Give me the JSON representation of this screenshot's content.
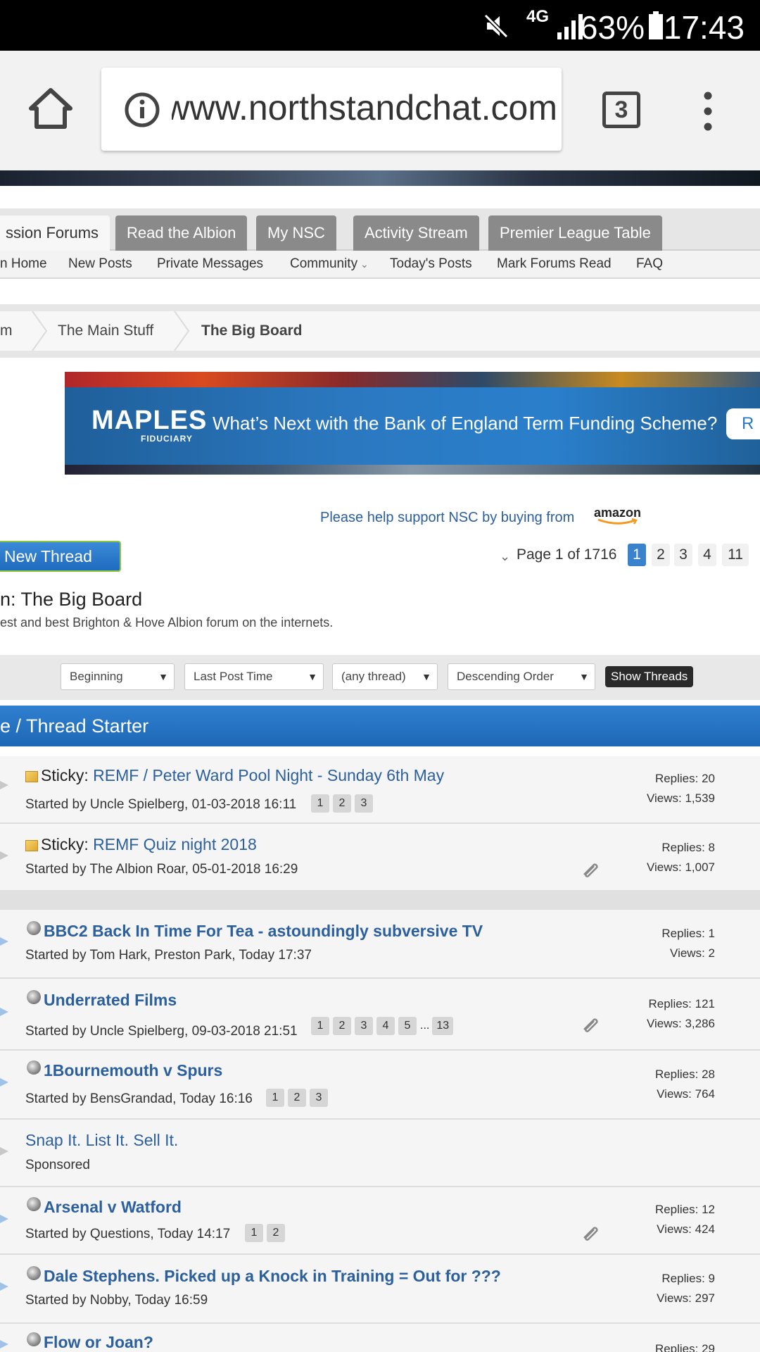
{
  "status_bar": {
    "network": "4G",
    "battery_percent": "63%",
    "time": "17:43"
  },
  "browser": {
    "url": "www.northstandchat.com",
    "tab_count": "3"
  },
  "nav": {
    "tabs": [
      "ssion Forums",
      "Read the Albion",
      "My NSC",
      "Activity Stream",
      "Premier League Table"
    ],
    "subnav": [
      "n Home",
      "New Posts",
      "Private Messages",
      "Community",
      "Today's Posts",
      "Mark Forums Read",
      "FAQ"
    ]
  },
  "breadcrumb": {
    "items": [
      "m",
      "The Main Stuff",
      "The Big Board"
    ]
  },
  "banner": {
    "brand": "MAPLES",
    "brand_sub": "FIDUCIARY",
    "headline": "What’s Next with the Bank of England Term Funding Scheme?",
    "cta": "R"
  },
  "support": {
    "text": "Please help support NSC by buying from",
    "amazon": "amazon"
  },
  "toolbar": {
    "new_thread": "New Thread",
    "page_label": "Page 1 of 1716",
    "pages": [
      "1",
      "2",
      "3",
      "4",
      "11"
    ]
  },
  "forum": {
    "title": "n: The Big Board",
    "description": "est and best Brighton & Hove Albion forum on the internets."
  },
  "filters": {
    "from": "Beginning",
    "sort_by": "Last Post Time",
    "prefix": "(any thread)",
    "order": "Descending Order",
    "submit": "Show Threads"
  },
  "list_header": "e / Thread Starter",
  "threads": [
    {
      "sticky": "Sticky:",
      "title": "REMF / Peter Ward Pool Night - Sunday 6th May",
      "meta": "Started by Uncle Spielberg, 01-03-2018 16:11",
      "pages": [
        "1",
        "2",
        "3"
      ],
      "replies": "Replies: 20",
      "views": "Views: 1,539"
    },
    {
      "sticky": "Sticky:",
      "title": "REMF Quiz night 2018",
      "meta": "Started by The Albion Roar, 05-01-2018 16:29",
      "pages": [],
      "replies": "Replies: 8",
      "views": "Views: 1,007"
    },
    {
      "title": "BBC2 Back In Time For Tea - astoundingly subversive TV",
      "meta": "Started by Tom Hark, Preston Park, Today 17:37",
      "pages": [],
      "replies": "Replies: 1",
      "views": "Views: 2"
    },
    {
      "title": "Underrated Films",
      "meta": "Started by Uncle Spielberg, 09-03-2018 21:51",
      "pages": [
        "1",
        "2",
        "3",
        "4",
        "5",
        "...",
        "13"
      ],
      "replies": "Replies: 121",
      "views": "Views: 3,286"
    },
    {
      "title": "1Bournemouth v Spurs",
      "meta": "Started by BensGrandad, Today 16:16",
      "pages": [
        "1",
        "2",
        "3"
      ],
      "replies": "Replies: 28",
      "views": "Views: 764"
    },
    {
      "title": "Snap It. List It. Sell It.",
      "meta": "Sponsored",
      "pages": [],
      "replies": "",
      "views": ""
    },
    {
      "title": "Arsenal v Watford",
      "meta": "Started by Questions, Today 14:17",
      "pages": [
        "1",
        "2"
      ],
      "replies": "Replies: 12",
      "views": "Views: 424"
    },
    {
      "title": "Dale Stephens. Picked up a Knock in Training = Out for ???",
      "meta": "Started by Nobby, Today 16:59",
      "pages": [],
      "replies": "Replies: 9",
      "views": "Views: 297"
    },
    {
      "title": "Flow or Joan?",
      "meta": "",
      "pages": [],
      "replies": "Replies: 29",
      "views": ""
    }
  ]
}
